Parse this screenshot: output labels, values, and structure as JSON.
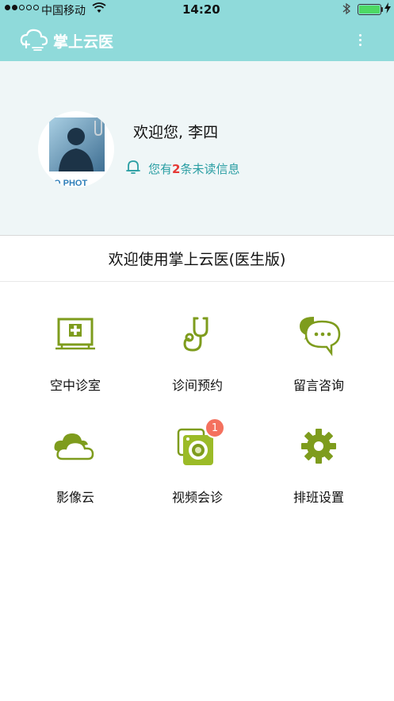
{
  "status_bar": {
    "carrier": "中国移动",
    "time": "14:20"
  },
  "navbar": {
    "title": "掌上云医",
    "logo_icon": "cloud-medical-icon",
    "menu_icon": "more-vertical-icon"
  },
  "profile": {
    "greeting": "欢迎您, 李四",
    "unread_prefix": "您有",
    "unread_count": "2",
    "unread_suffix": "条未读信息"
  },
  "welcome": "欢迎使用掌上云医(医生版)",
  "menu": [
    {
      "label": "空中诊室",
      "icon": "monitor-cross-icon"
    },
    {
      "label": "诊间预约",
      "icon": "stethoscope-icon"
    },
    {
      "label": "留言咨询",
      "icon": "chat-bubbles-icon"
    },
    {
      "label": "影像云",
      "icon": "cloud-icon"
    },
    {
      "label": "视频会诊",
      "icon": "camera-icon",
      "badge": "1"
    },
    {
      "label": "排班设置",
      "icon": "gear-icon"
    }
  ],
  "colors": {
    "header": "#8fdada",
    "icon_green": "#7e9c1d",
    "accent_text": "#2a9ea3",
    "badge": "#f4715e"
  }
}
